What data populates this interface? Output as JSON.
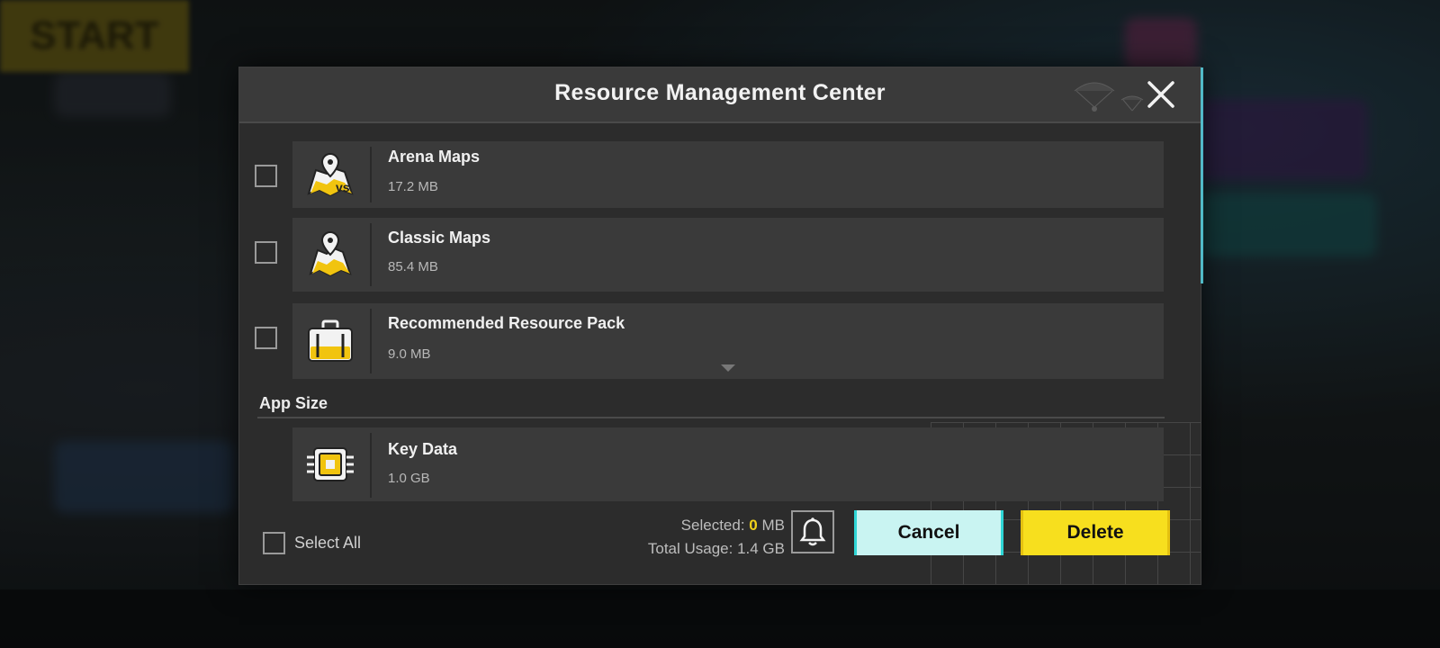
{
  "dialog": {
    "title": "Resource Management Center",
    "items": [
      {
        "name": "Arena Maps",
        "size": "17.2 MB",
        "icon": "arena-map-icon"
      },
      {
        "name": "Classic Maps",
        "size": "85.4 MB",
        "icon": "classic-map-icon"
      },
      {
        "name": "Recommended Resource Pack",
        "size": "9.0 MB",
        "icon": "briefcase-icon"
      }
    ],
    "app_size_label": "App Size",
    "key_data": {
      "name": "Key Data",
      "size": "1.0 GB",
      "icon": "chip-icon"
    },
    "footer": {
      "select_all": "Select All",
      "selected_label": "Selected:",
      "selected_value": "0",
      "selected_unit": "MB",
      "total_usage": "Total Usage: 1.4 GB",
      "cancel": "Cancel",
      "delete": "Delete"
    }
  },
  "background": {
    "start_label": "START"
  },
  "colors": {
    "accent_yellow": "#f7df1e",
    "accent_cyan": "#c9f4f2",
    "panel": "#2c2c2c",
    "card": "#3a3a3a"
  }
}
